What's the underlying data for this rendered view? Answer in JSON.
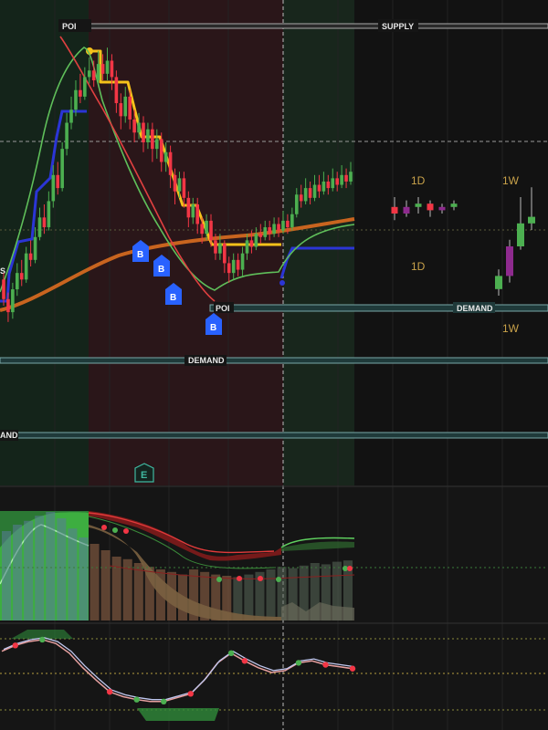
{
  "zones": {
    "poi_top": "POI",
    "supply": "SUPPLY",
    "poi_mid": "POI",
    "demand_right": "DEMAND",
    "demand_mid": "DEMAND",
    "demand_left": "AND",
    "left_cut": "S"
  },
  "timeframes": {
    "d1_top": "1D",
    "w1_top": "1W",
    "d1_mid": "1D",
    "w1_bot": "1W"
  },
  "markers": {
    "buy": [
      "B",
      "B",
      "B",
      "B"
    ],
    "earnings": "E"
  },
  "colors": {
    "bull": "#4caf50",
    "bear": "#f23645",
    "ma_orange": "#c8641f",
    "stop_yellow": "#f5c21a",
    "stop_blue": "#2b35d6",
    "buy_badge": "#2962ff",
    "zone_fill": "#22403e",
    "supply_line": "#a0a0a0"
  },
  "chart_data": [
    {
      "type": "candlestick",
      "title": "",
      "series": [
        {
          "name": "",
          "values": [
            [
              70,
              64,
              72,
              62
            ],
            [
              64,
              60,
              66,
              57
            ],
            [
              60,
              67,
              69,
              58
            ],
            [
              67,
              72,
              75,
              65
            ],
            [
              72,
              70,
              76,
              68
            ],
            [
              70,
              78,
              80,
              69
            ],
            [
              78,
              76,
              82,
              74
            ],
            [
              76,
              83,
              86,
              75
            ],
            [
              83,
              89,
              92,
              82
            ],
            [
              89,
              86,
              93,
              84
            ],
            [
              86,
              94,
              97,
              85
            ],
            [
              94,
              102,
              105,
              92
            ],
            [
              102,
              98,
              106,
              96
            ],
            [
              98,
              110,
              112,
              97
            ],
            [
              110,
              118,
              121,
              108
            ],
            [
              118,
              122,
              126,
              116
            ],
            [
              122,
              128,
              131,
              120
            ],
            [
              128,
              126,
              133,
              124
            ],
            [
              126,
              132,
              135,
              125
            ],
            [
              132,
              134,
              138,
              130
            ],
            [
              134,
              131,
              137,
              129
            ],
            [
              131,
              136,
              140,
              130
            ],
            [
              136,
              133,
              139,
              131
            ],
            [
              133,
              137,
              141,
              131
            ],
            [
              137,
              132,
              139,
              128
            ],
            [
              132,
              124,
              134,
              121
            ],
            [
              124,
              120,
              127,
              116
            ],
            [
              120,
              126,
              129,
              118
            ],
            [
              126,
              119,
              128,
              116
            ],
            [
              119,
              115,
              122,
              112
            ],
            [
              115,
              118,
              121,
              113
            ],
            [
              118,
              112,
              120,
              109
            ],
            [
              112,
              116,
              118,
              110
            ],
            [
              116,
              110,
              118,
              106
            ],
            [
              110,
              113,
              116,
              107
            ],
            [
              113,
              106,
              115,
              103
            ],
            [
              106,
              109,
              112,
              103
            ],
            [
              109,
              102,
              111,
              98
            ],
            [
              102,
              97,
              104,
              93
            ],
            [
              97,
              101,
              103,
              95
            ],
            [
              101,
              95,
              103,
              92
            ],
            [
              95,
              89,
              97,
              86
            ],
            [
              89,
              93,
              95,
              87
            ],
            [
              93,
              87,
              95,
              84
            ],
            [
              87,
              84,
              89,
              81
            ],
            [
              84,
              88,
              90,
              82
            ],
            [
              88,
              82,
              90,
              80
            ],
            [
              82,
              78,
              84,
              76
            ],
            [
              78,
              81,
              84,
              76
            ],
            [
              81,
              75,
              82,
              72
            ],
            [
              75,
              72,
              77,
              69
            ],
            [
              72,
              76,
              78,
              70
            ],
            [
              76,
              73,
              78,
              71
            ],
            [
              73,
              78,
              80,
              71
            ],
            [
              78,
              82,
              84,
              76
            ],
            [
              82,
              80,
              85,
              78
            ],
            [
              80,
              84,
              86,
              79
            ],
            [
              84,
              83,
              87,
              81
            ],
            [
              83,
              86,
              88,
              82
            ],
            [
              86,
              84,
              88,
              82
            ],
            [
              84,
              87,
              89,
              83
            ],
            [
              87,
              85,
              89,
              83
            ],
            [
              85,
              88,
              91,
              84
            ],
            [
              88,
              86,
              90,
              84
            ],
            [
              86,
              90,
              92,
              85
            ],
            [
              90,
              96,
              98,
              89
            ],
            [
              96,
              94,
              99,
              92
            ],
            [
              94,
              98,
              101,
              93
            ],
            [
              98,
              95,
              100,
              93
            ],
            [
              95,
              99,
              102,
              94
            ],
            [
              99,
              97,
              102,
              95
            ],
            [
              97,
              100,
              103,
              96
            ],
            [
              100,
              98,
              102,
              96
            ],
            [
              98,
              101,
              104,
              97
            ],
            [
              101,
              99,
              103,
              97
            ],
            [
              99,
              102,
              105,
              98
            ],
            [
              102,
              100,
              104,
              98
            ],
            [
              100,
              103,
              106,
              99
            ]
          ]
        }
      ],
      "ylim": [
        55,
        150
      ],
      "zones": [
        {
          "name": "SUPPLY",
          "price": 145
        },
        {
          "name": "POI",
          "price": 79
        },
        {
          "name": "DEMAND",
          "price": 79
        },
        {
          "name": "DEMAND",
          "price": 62
        },
        {
          "name": "AND",
          "price": 45
        }
      ],
      "higher_tf": {
        "1D": [
          [
            97,
            95,
            100,
            93
          ],
          [
            95,
            97,
            99,
            94
          ],
          [
            97,
            98,
            100,
            95
          ],
          [
            98,
            96,
            99,
            94
          ],
          [
            96,
            97,
            98,
            95
          ],
          [
            97,
            98,
            99,
            96
          ]
        ],
        "1W": [
          [
            72,
            76,
            78,
            70
          ],
          [
            76,
            85,
            87,
            74
          ],
          [
            85,
            92,
            100,
            84
          ],
          [
            92,
            94,
            103,
            90
          ]
        ]
      },
      "grid": true
    },
    {
      "type": "area",
      "title": "",
      "series": [
        {
          "name": "",
          "values": [
            70,
            75,
            78,
            82,
            85,
            80,
            72,
            65,
            60,
            55,
            50,
            48,
            45,
            42,
            40,
            38,
            36,
            40,
            38,
            36,
            35,
            34,
            36,
            38,
            40,
            42,
            41,
            43,
            45,
            44,
            46,
            47
          ]
        }
      ],
      "grid": true
    },
    {
      "type": "line",
      "title": "",
      "series": [
        {
          "name": "",
          "values": [
            72,
            78,
            82,
            84,
            80,
            70,
            55,
            42,
            30,
            25,
            22,
            20,
            20,
            24,
            28,
            42,
            60,
            70,
            62,
            55,
            50,
            52,
            60,
            62,
            58,
            56,
            54
          ]
        }
      ],
      "ylim": [
        0,
        100
      ],
      "grid": true
    }
  ]
}
